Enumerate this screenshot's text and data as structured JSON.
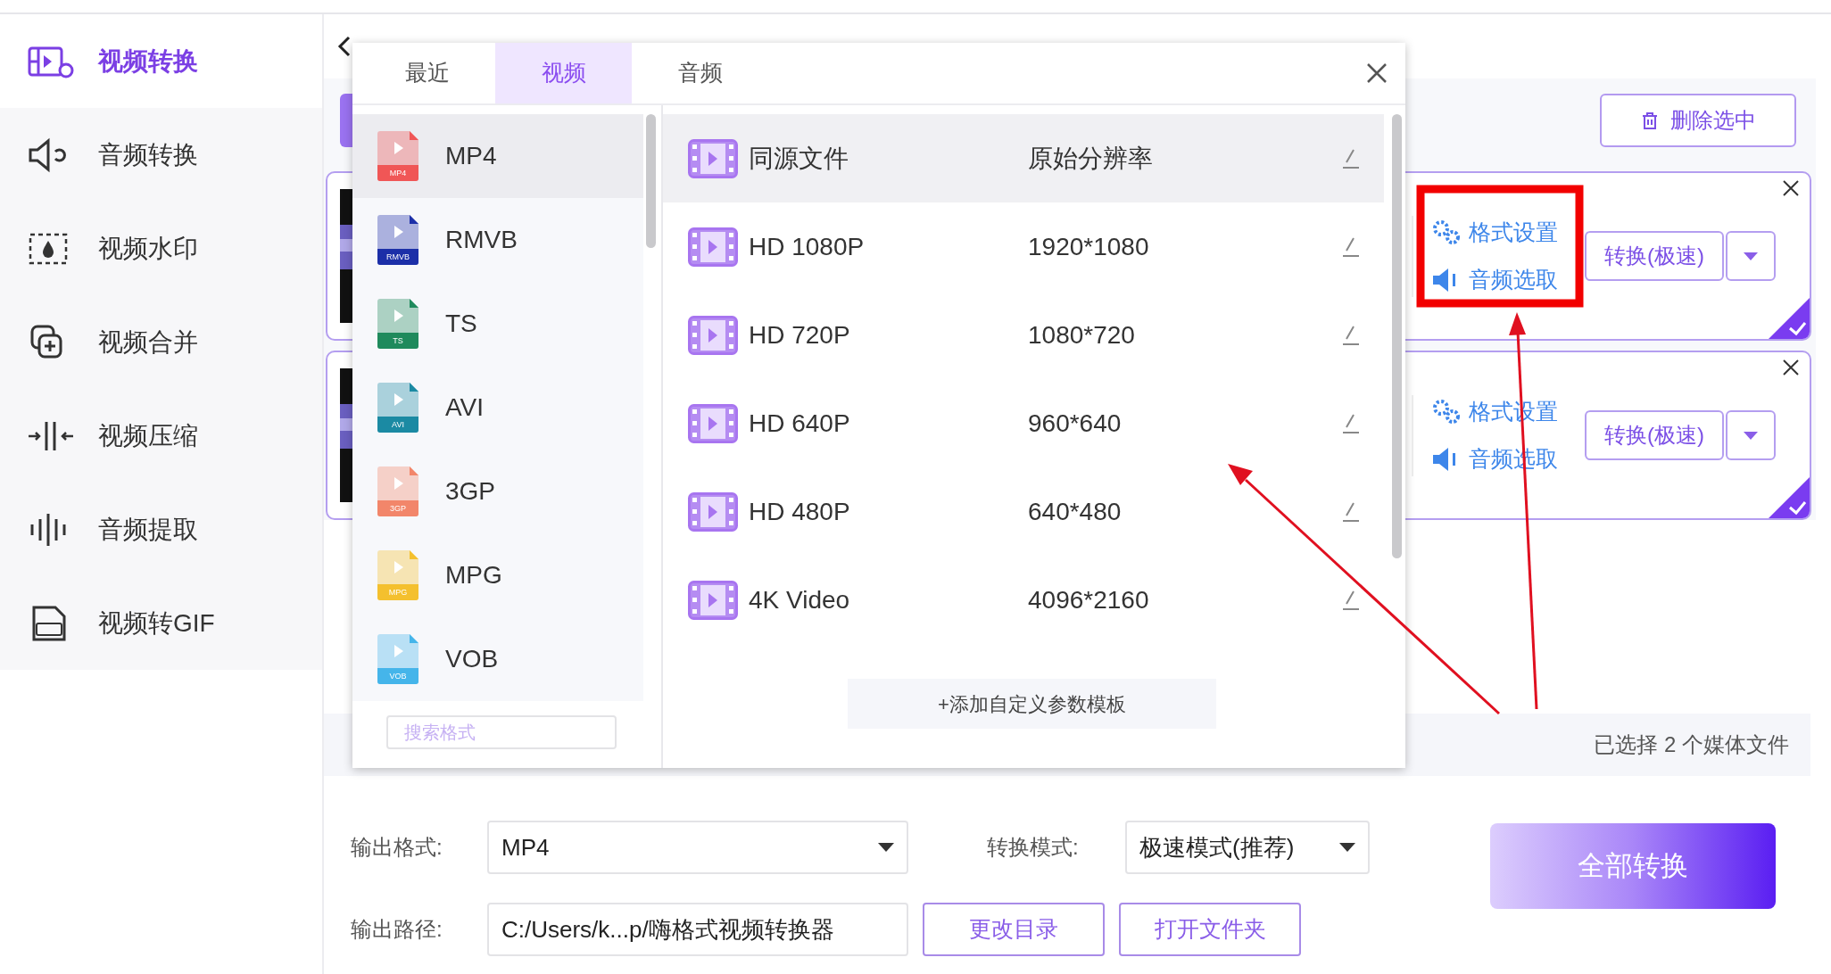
{
  "sidebar": {
    "items": [
      {
        "label": "视频转换",
        "selected": true
      },
      {
        "label": "音频转换",
        "selected": false
      },
      {
        "label": "视频水印",
        "selected": false
      },
      {
        "label": "视频合并",
        "selected": false
      },
      {
        "label": "视频压缩",
        "selected": false
      },
      {
        "label": "音频提取",
        "selected": false
      },
      {
        "label": "视频转GIF",
        "selected": false
      }
    ]
  },
  "toolbar": {
    "delete_button": "删除选中"
  },
  "files": [
    {
      "format_settings": "格式设置",
      "audio_select": "音频选取",
      "convert_button": "转换(极速)",
      "checked": true
    },
    {
      "format_settings": "格式设置",
      "audio_select": "音频选取",
      "convert_button": "转换(极速)",
      "checked": true
    }
  ],
  "status": {
    "selection_summary": "已选择 2 个媒体文件"
  },
  "format_popup": {
    "tabs": [
      {
        "label": "最近",
        "selected": false
      },
      {
        "label": "视频",
        "selected": true
      },
      {
        "label": "音频",
        "selected": false
      }
    ],
    "formats": [
      {
        "label": "MP4",
        "badge": "MP4",
        "color": "#f05656",
        "selected": true
      },
      {
        "label": "RMVB",
        "badge": "RMVB",
        "color": "#1c2fa8",
        "selected": false
      },
      {
        "label": "TS",
        "badge": "TS",
        "color": "#1f8a5c",
        "selected": false
      },
      {
        "label": "AVI",
        "badge": "AVI",
        "color": "#1b8aa3",
        "selected": false
      },
      {
        "label": "3GP",
        "badge": "3GP",
        "color": "#f2866a",
        "selected": false
      },
      {
        "label": "MPG",
        "badge": "MPG",
        "color": "#f4c02e",
        "selected": false
      },
      {
        "label": "VOB",
        "badge": "VOB",
        "color": "#45b5ea",
        "selected": false
      }
    ],
    "search": {
      "placeholder": "搜索格式"
    },
    "presets": [
      {
        "name": "同源文件",
        "resolution": "原始分辨率",
        "selected": true
      },
      {
        "name": "HD 1080P",
        "resolution": "1920*1080",
        "selected": false
      },
      {
        "name": "HD 720P",
        "resolution": "1080*720",
        "selected": false
      },
      {
        "name": "HD 640P",
        "resolution": "960*640",
        "selected": false
      },
      {
        "name": "HD 480P",
        "resolution": "640*480",
        "selected": false
      },
      {
        "name": "4K Video",
        "resolution": "4096*2160",
        "selected": false
      }
    ],
    "add_template_button": "+添加自定义参数模板"
  },
  "output": {
    "format_label": "输出格式:",
    "format_value": "MP4",
    "mode_label": "转换模式:",
    "mode_value": "极速模式(推荐)",
    "path_label": "输出路径:",
    "path_value": "C:/Users/k...p/嗨格式视频转换器",
    "change_dir_button": "更改目录",
    "open_folder_button": "打开文件夹",
    "convert_all_button": "全部转换"
  }
}
